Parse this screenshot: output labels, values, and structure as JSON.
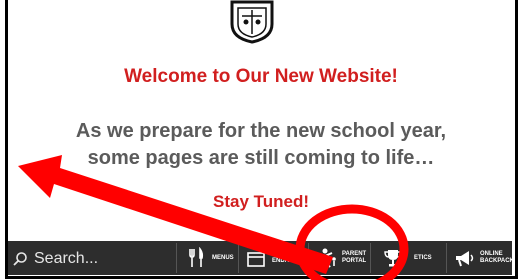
{
  "welcome_heading": "Welcome to Our New Website!",
  "message_line1": "As we prepare for the new school year,",
  "message_line2": "some pages are still coming to life…",
  "stay_tuned": "Stay Tuned!",
  "footer": {
    "search_placeholder": "Search...",
    "items": [
      {
        "label": "MENUS",
        "icon": "fork-knife-icon"
      },
      {
        "label_line1": "TRICT",
        "label_line2": "ENDAR",
        "icon": "calendar-icon"
      },
      {
        "label_line1": "PARENT",
        "label_line2": "PORTAL",
        "icon": "parent-figure-icon"
      },
      {
        "label": "ETICS",
        "icon": "trophy-icon"
      },
      {
        "label_line1": "ONLINE",
        "label_line2": "BACKPACK",
        "icon": "megaphone-icon"
      }
    ]
  },
  "colors": {
    "heading_red": "#d11f1f",
    "body_gray": "#5b5b5b",
    "footer_bg": "#2d2d2d",
    "annotation_red": "#ff0000"
  }
}
